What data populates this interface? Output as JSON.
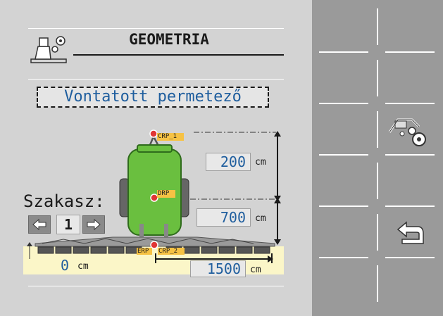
{
  "header": {
    "title": "GEOMETRIA",
    "icon": "sprayer-settings-icon"
  },
  "subtitle": "Vontatott permetező",
  "section": {
    "label": "Szakasz:",
    "value": "1"
  },
  "points": {
    "crp1": "CRP_1",
    "drp": "DRP",
    "erp": "ERP",
    "crp2": "CRP_2"
  },
  "distances": {
    "top": {
      "value": "200",
      "unit": "cm"
    },
    "middle": {
      "value": "700",
      "unit": "cm"
    },
    "lateral": {
      "value": "1500",
      "unit": "cm"
    },
    "offset": {
      "value": "0",
      "unit": "cm"
    }
  },
  "softkeys": {
    "machine_settings_icon": "sprayer-gear-icon",
    "back_icon": "return-arrow-icon"
  },
  "colors": {
    "value_text": "#1f5e9e",
    "tank_green": "#6abf3f",
    "label_yellow": "#f6c244",
    "point_red": "#e03535",
    "softkey_bg": "#9a9a9a",
    "strip_yellow": "#fbf6c8"
  }
}
